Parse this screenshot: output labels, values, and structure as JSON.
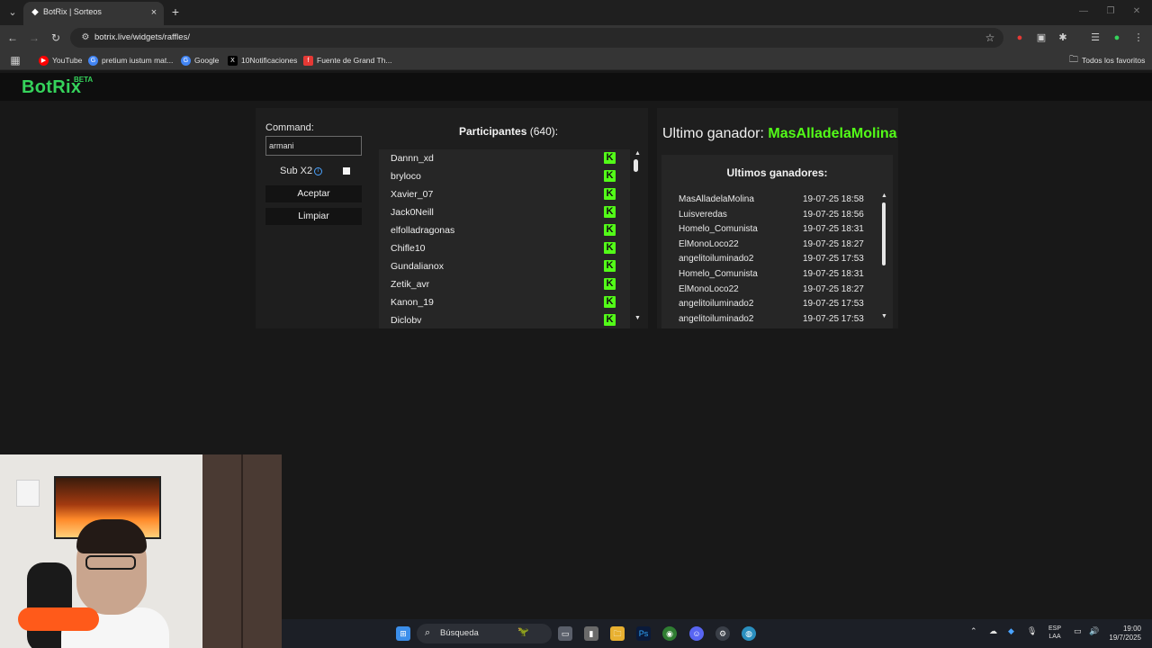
{
  "browser": {
    "tab_title": "BotRix | Sorteos",
    "tab_close": "×",
    "new_tab": "+",
    "url": "botrix.live/widgets/raffles/",
    "bookmarks": [
      {
        "label": "YouTube",
        "color": "#ff0000"
      },
      {
        "label": "pretium iustum mat...",
        "color": "#4285f4"
      },
      {
        "label": "Google",
        "color": "#4285f4"
      },
      {
        "label": "10Notificaciones",
        "color": "#000000"
      },
      {
        "label": "Fuente de Grand Th...",
        "color": "#e53935"
      }
    ],
    "all_bookmarks": "Todos los favoritos"
  },
  "site": {
    "logo": "BotRix",
    "beta": "BETA"
  },
  "controls": {
    "command_label": "Command:",
    "command_value": "armani",
    "sub_label": "Sub X2",
    "accept_label": "Aceptar",
    "clear_label": "Limpiar"
  },
  "participants": {
    "title": "Participantes",
    "count": "(640):",
    "items": [
      "Dannn_xd",
      "bryloco",
      "Xavier_07",
      "Jack0Neill",
      "elfolladragonas",
      "Chifle10",
      "Gundalianox",
      "Zetik_avr",
      "Kanon_19",
      "Diclobv"
    ]
  },
  "winners": {
    "last_label": "Ultimo ganador:",
    "last_name": "MasAlladelaMolina",
    "title": "Ultimos ganadores:",
    "items": [
      {
        "name": "MasAlladelaMolina",
        "date": "19-07-25 18:58"
      },
      {
        "name": "Luisveredas",
        "date": "19-07-25 18:56"
      },
      {
        "name": "Homelo_Comunista",
        "date": "19-07-25 18:31"
      },
      {
        "name": "ElMonoLoco22",
        "date": "19-07-25 18:27"
      },
      {
        "name": "angelitoiluminado2",
        "date": "19-07-25 17:53"
      },
      {
        "name": "Homelo_Comunista",
        "date": "19-07-25 18:31"
      },
      {
        "name": "ElMonoLoco22",
        "date": "19-07-25 18:27"
      },
      {
        "name": "angelitoiluminado2",
        "date": "19-07-25 17:53"
      },
      {
        "name": "angelitoiluminado2",
        "date": "19-07-25 17:53"
      }
    ]
  },
  "taskbar": {
    "search": "Búsqueda",
    "lang_top": "ESP",
    "lang_bottom": "LAA",
    "time": "19:00",
    "date": "19/7/2025"
  },
  "colors": {
    "accent_green": "#53fc18",
    "logo_green": "#35d35b",
    "info_blue": "#4aa3ff"
  }
}
